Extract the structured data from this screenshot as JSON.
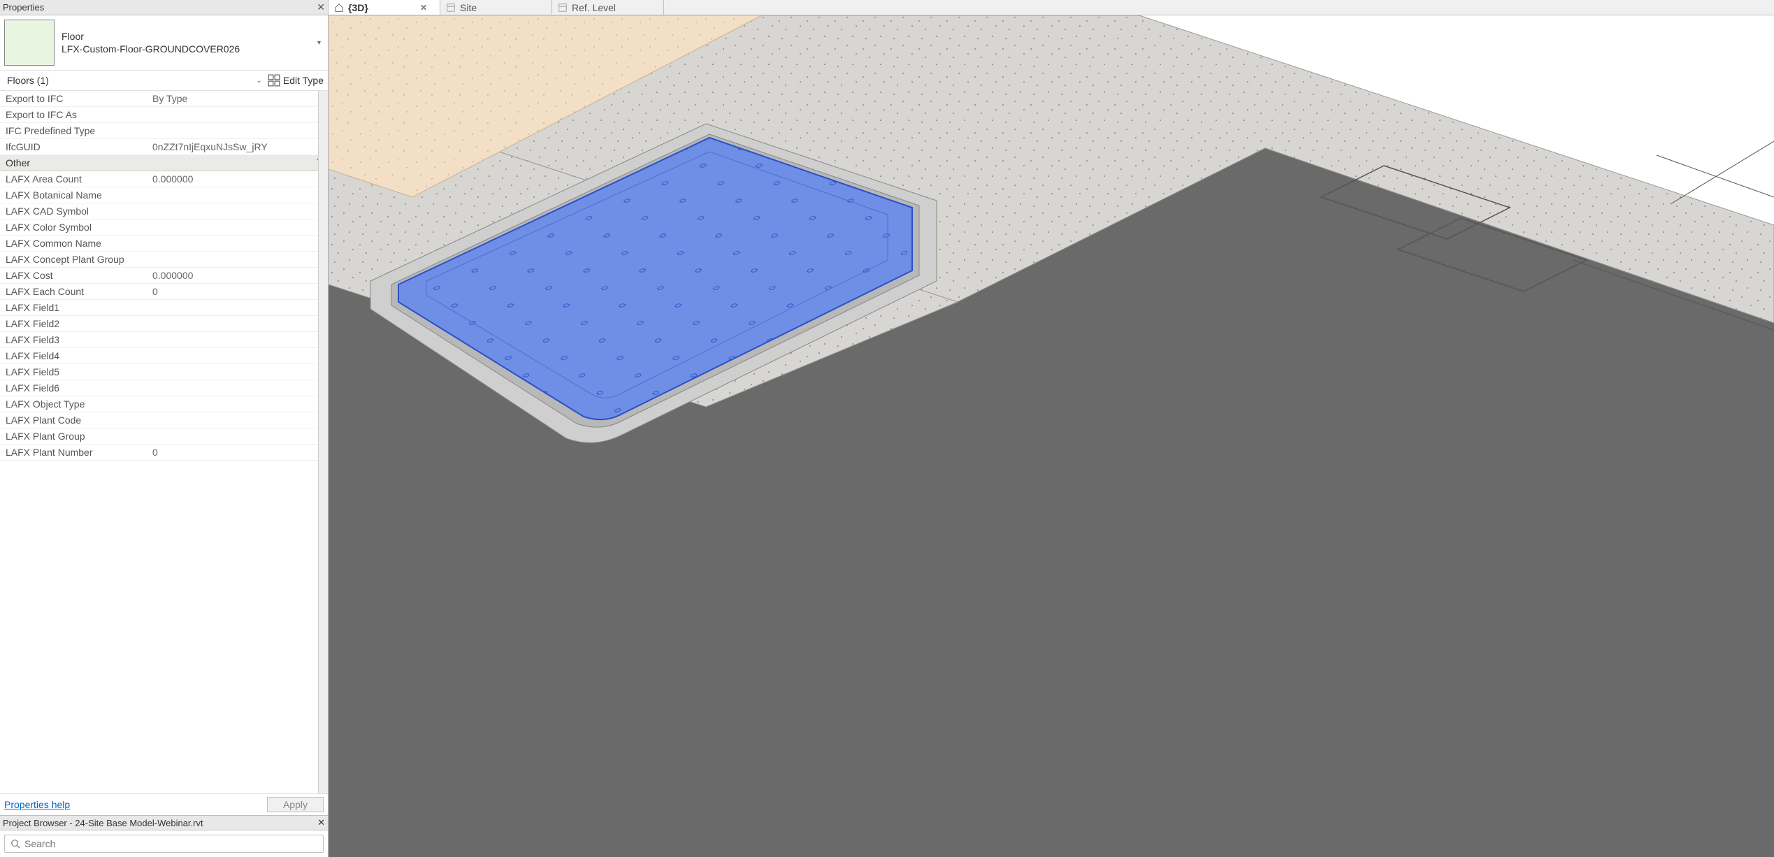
{
  "properties": {
    "panel_title": "Properties",
    "category": "Floor",
    "type_name": "LFX-Custom-Floor-GROUNDCOVER026",
    "instance_label": "Floors (1)",
    "edit_type_label": "Edit Type",
    "rows": [
      {
        "label": "Export to IFC",
        "value": "By Type"
      },
      {
        "label": "Export to IFC As",
        "value": ""
      },
      {
        "label": "IFC Predefined Type",
        "value": ""
      },
      {
        "label": "IfcGUID",
        "value": "0nZZt7nIjEqxuNJsSw_jRY"
      }
    ],
    "group_other": "Other",
    "other_rows": [
      {
        "label": "LAFX Area Count",
        "value": "0.000000"
      },
      {
        "label": "LAFX Botanical Name",
        "value": ""
      },
      {
        "label": "LAFX CAD Symbol",
        "value": ""
      },
      {
        "label": "LAFX Color Symbol",
        "value": ""
      },
      {
        "label": "LAFX Common Name",
        "value": ""
      },
      {
        "label": "LAFX Concept Plant Group",
        "value": ""
      },
      {
        "label": "LAFX Cost",
        "value": "0.000000"
      },
      {
        "label": "LAFX Each Count",
        "value": "0"
      },
      {
        "label": "LAFX Field1",
        "value": ""
      },
      {
        "label": "LAFX Field2",
        "value": ""
      },
      {
        "label": "LAFX Field3",
        "value": ""
      },
      {
        "label": "LAFX Field4",
        "value": ""
      },
      {
        "label": "LAFX Field5",
        "value": ""
      },
      {
        "label": "LAFX Field6",
        "value": ""
      },
      {
        "label": "LAFX Object Type",
        "value": ""
      },
      {
        "label": "LAFX Plant Code",
        "value": ""
      },
      {
        "label": "LAFX Plant Group",
        "value": ""
      },
      {
        "label": "LAFX Plant Number",
        "value": "0"
      }
    ],
    "help_label": "Properties help",
    "apply_label": "Apply"
  },
  "browser": {
    "title": "Project Browser - 24-Site Base Model-Webinar.rvt",
    "search_placeholder": "Search"
  },
  "tabs": {
    "items": [
      {
        "label": "{3D}",
        "active": true,
        "icon": "home"
      },
      {
        "label": "Site",
        "active": false,
        "icon": "sheet"
      },
      {
        "label": "Ref. Level",
        "active": false,
        "icon": "sheet"
      }
    ]
  }
}
